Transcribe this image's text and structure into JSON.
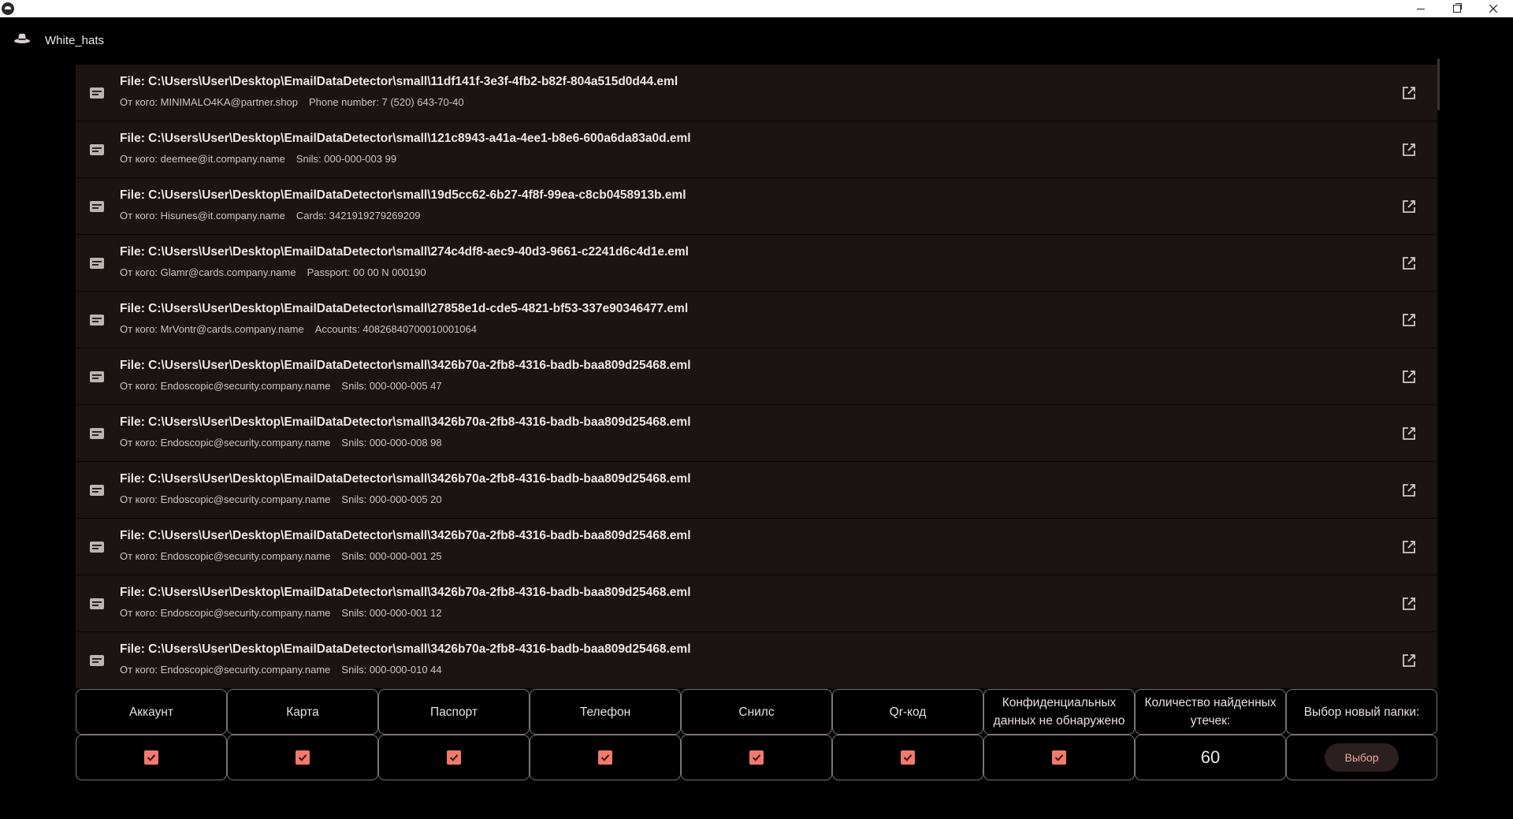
{
  "window": {
    "minimize_icon": "minimize-icon",
    "maximize_icon": "restore-icon",
    "close_icon": "close-icon"
  },
  "app": {
    "title": "White_hats",
    "logo_icon": "hat-icon"
  },
  "files": [
    {
      "path": "File: C:\\Users\\User\\Desktop\\EmailDataDetector\\small\\11df141f-3e3f-4fb2-b82f-804a515d0d44.eml",
      "from": "От кого: MINIMALO4KA@partner.shop",
      "leak": "Phone number: 7 (520) 643-70-40"
    },
    {
      "path": "File: C:\\Users\\User\\Desktop\\EmailDataDetector\\small\\121c8943-a41a-4ee1-b8e6-600a6da83a0d.eml",
      "from": "От кого: deemee@it.company.name",
      "leak": "Snils: 000-000-003 99"
    },
    {
      "path": "File: C:\\Users\\User\\Desktop\\EmailDataDetector\\small\\19d5cc62-6b27-4f8f-99ea-c8cb0458913b.eml",
      "from": "От кого: Hisunes@it.company.name",
      "leak": "Cards: 3421919279269209"
    },
    {
      "path": "File: C:\\Users\\User\\Desktop\\EmailDataDetector\\small\\274c4df8-aec9-40d3-9661-c2241d6c4d1e.eml",
      "from": "От кого: Glamr@cards.company.name",
      "leak": "Passport: 00 00 N 000190"
    },
    {
      "path": "File: C:\\Users\\User\\Desktop\\EmailDataDetector\\small\\27858e1d-cde5-4821-bf53-337e90346477.eml",
      "from": "От кого: MrVontr@cards.company.name",
      "leak": "Accounts: 40826840700010001064"
    },
    {
      "path": "File: C:\\Users\\User\\Desktop\\EmailDataDetector\\small\\3426b70a-2fb8-4316-badb-baa809d25468.eml",
      "from": "От кого: Endoscopic@security.company.name",
      "leak": "Snils: 000-000-005 47"
    },
    {
      "path": "File: C:\\Users\\User\\Desktop\\EmailDataDetector\\small\\3426b70a-2fb8-4316-badb-baa809d25468.eml",
      "from": "От кого: Endoscopic@security.company.name",
      "leak": "Snils: 000-000-008 98"
    },
    {
      "path": "File: C:\\Users\\User\\Desktop\\EmailDataDetector\\small\\3426b70a-2fb8-4316-badb-baa809d25468.eml",
      "from": "От кого: Endoscopic@security.company.name",
      "leak": "Snils: 000-000-005 20"
    },
    {
      "path": "File: C:\\Users\\User\\Desktop\\EmailDataDetector\\small\\3426b70a-2fb8-4316-badb-baa809d25468.eml",
      "from": "От кого: Endoscopic@security.company.name",
      "leak": "Snils: 000-000-001 25"
    },
    {
      "path": "File: C:\\Users\\User\\Desktop\\EmailDataDetector\\small\\3426b70a-2fb8-4316-badb-baa809d25468.eml",
      "from": "От кого: Endoscopic@security.company.name",
      "leak": "Snils: 000-000-001 12"
    },
    {
      "path": "File: C:\\Users\\User\\Desktop\\EmailDataDetector\\small\\3426b70a-2fb8-4316-badb-baa809d25468.eml",
      "from": "От кого: Endoscopic@security.company.name",
      "leak": "Snils: 000-000-010 44"
    }
  ],
  "list_icons": {
    "item": "email-file-icon",
    "open": "open-in-new-icon"
  },
  "filters": {
    "account": {
      "label": "Аккаунт",
      "checked": true
    },
    "card": {
      "label": "Карта",
      "checked": true
    },
    "passport": {
      "label": "Паспорт",
      "checked": true
    },
    "phone": {
      "label": "Телефон",
      "checked": true
    },
    "snils": {
      "label": "Снилс",
      "checked": true
    },
    "qr": {
      "label": "Qr-код",
      "checked": true
    },
    "no_data": {
      "label_line1": "Конфиденциальных",
      "label_line2": "данных не обнаружено",
      "checked": true
    }
  },
  "count": {
    "label_line1": "Количество найденных",
    "label_line2": "утечек:",
    "value": "60"
  },
  "folder": {
    "label": "Выбор новый папки:",
    "button": "Выбор"
  },
  "colors": {
    "background": "#000000",
    "row": "#1c1413",
    "accent": "#f07a6d",
    "button_text": "#f0a79f",
    "border": "#7d7370"
  }
}
